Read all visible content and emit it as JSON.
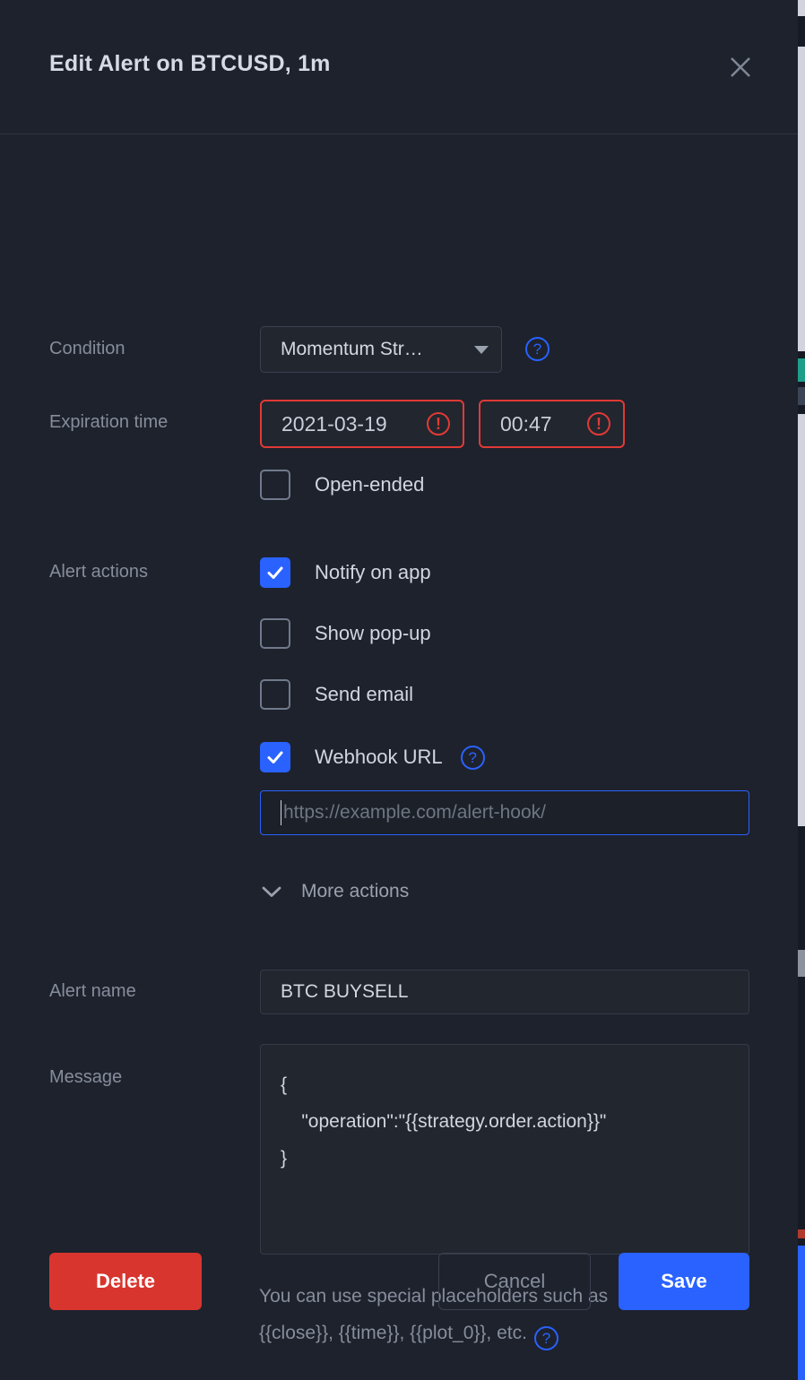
{
  "dialog": {
    "title": "Edit Alert on BTCUSD, 1m",
    "close_icon": "close-icon"
  },
  "form": {
    "condition": {
      "label": "Condition",
      "selected": "Momentum Str…",
      "help_icon": "question-mark-icon"
    },
    "expiration": {
      "label": "Expiration time",
      "date_value": "2021-03-19",
      "time_value": "00:47",
      "date_error_icon": "error-exclamation-icon",
      "time_error_icon": "error-exclamation-icon",
      "open_ended": {
        "label": "Open-ended",
        "checked": false
      }
    },
    "alert_actions": {
      "label": "Alert actions",
      "items": [
        {
          "label": "Notify on app",
          "checked": true
        },
        {
          "label": "Show pop-up",
          "checked": false
        },
        {
          "label": "Send email",
          "checked": false
        },
        {
          "label": "Webhook URL",
          "checked": true,
          "help_icon": "question-mark-icon"
        }
      ],
      "webhook_placeholder": "https://example.com/alert-hook/",
      "webhook_value": "",
      "more_actions_label": "More actions",
      "more_actions_icon": "chevron-down-icon"
    },
    "alert_name": {
      "label": "Alert name",
      "value": "BTC BUYSELL"
    },
    "message": {
      "label": "Message",
      "value": "{\n    \"operation\":\"{{strategy.order.action}}\"\n}",
      "hint_line1": "You can use special placeholders such as",
      "hint_line2": "{{close}}, {{time}}, {{plot_0}}, etc.",
      "hint_help_icon": "question-mark-icon"
    }
  },
  "footer": {
    "delete_label": "Delete",
    "cancel_label": "Cancel",
    "save_label": "Save"
  },
  "colors": {
    "accent_blue": "#2962ff",
    "danger_red": "#d8352f",
    "error_border": "#e03a35",
    "panel_bg": "#1e222d",
    "field_bg": "#22262f",
    "label_text": "#868d9b",
    "value_text": "#d2d6de"
  }
}
